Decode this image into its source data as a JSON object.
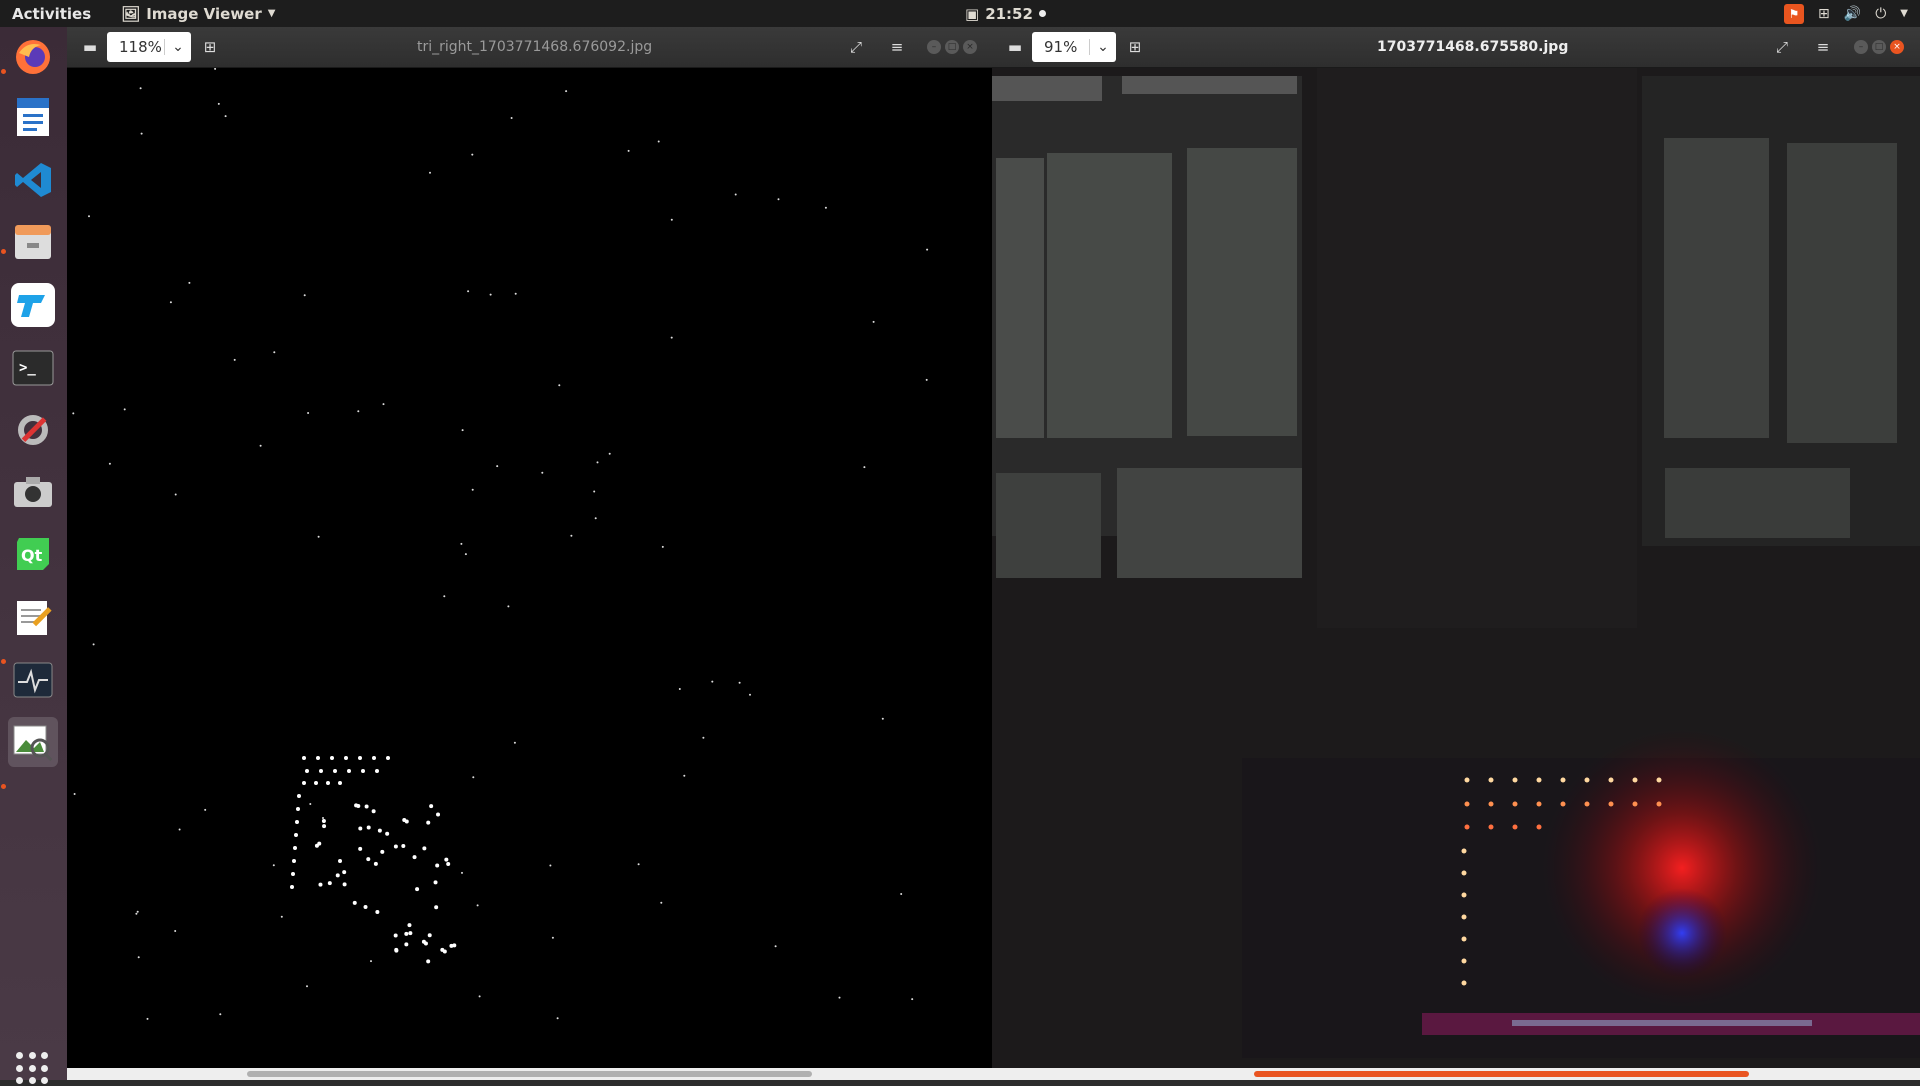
{
  "topbar": {
    "activities": "Activities",
    "app_name": "Image Viewer",
    "clock": "21:52"
  },
  "left_viewer": {
    "zoom": "118%",
    "title": "tri_right_1703771468.676092.jpg"
  },
  "right_viewer": {
    "zoom": "91%",
    "title": "1703771468.675580.jpg"
  },
  "dock": {
    "items": [
      "firefox-icon",
      "writer-icon",
      "vscode-icon",
      "files-icon",
      "tencent-icon",
      "terminal-icon",
      "settings-tools-icon",
      "camera-icon",
      "qt-creator-icon",
      "text-editor-icon",
      "system-monitor-icon",
      "image-viewer-icon"
    ]
  },
  "colors": {
    "accent": "#e95420",
    "dock_bg": "#3b2b37",
    "topbar_bg": "#1d1d1d"
  }
}
